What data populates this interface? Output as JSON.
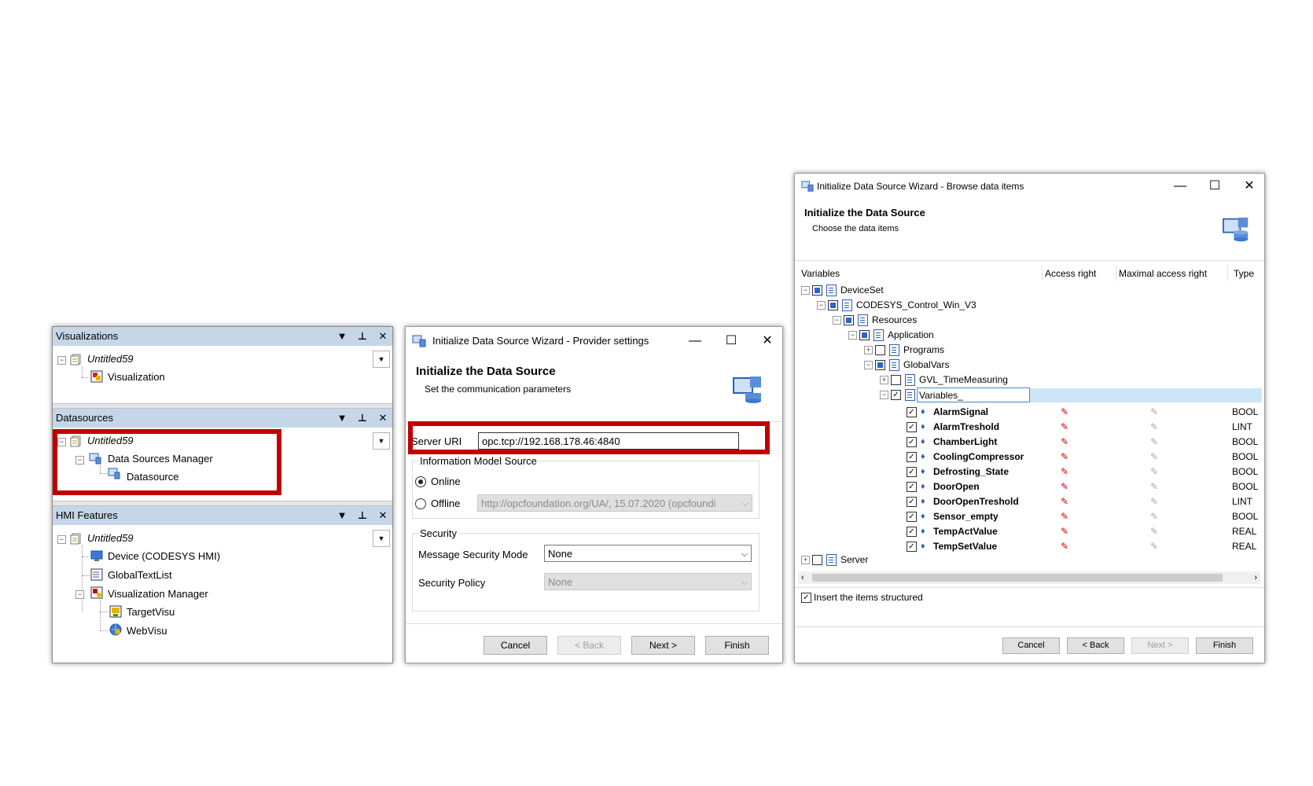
{
  "left_panel": {
    "visualizations": {
      "header": "Visualizations",
      "root": "Untitled59",
      "children": [
        "Visualization"
      ]
    },
    "datasources": {
      "header": "Datasources",
      "root": "Untitled59",
      "manager": "Data Sources Manager",
      "child": "Datasource"
    },
    "hmi_features": {
      "header": "HMI Features",
      "root": "Untitled59",
      "device": "Device (CODESYS HMI)",
      "textlist": "GlobalTextList",
      "manager": "Visualization Manager",
      "target": "TargetVisu",
      "web": "WebVisu"
    }
  },
  "provider_dialog": {
    "title": "Initialize Data Source Wizard - Provider settings",
    "heading": "Initialize the Data Source",
    "subheading": "Set the communication parameters",
    "server_uri_label": "Server URI",
    "server_uri_value": "opc.tcp://192.168.178.46:4840",
    "info_model_group": "Information Model Source",
    "online_label": "Online",
    "offline_label": "Offline",
    "offline_value": "http://opcfoundation.org/UA/, 15.07.2020 (opcfoundi",
    "security_group": "Security",
    "msg_security_label": "Message Security Mode",
    "msg_security_value": "None",
    "policy_label": "Security Policy",
    "policy_value": "None",
    "buttons": {
      "cancel": "Cancel",
      "back": "< Back",
      "next": "Next >",
      "finish": "Finish"
    }
  },
  "browse_dialog": {
    "title": "Initialize Data Source Wizard - Browse data items",
    "heading": "Initialize the Data Source",
    "subheading": "Choose the data items",
    "columns": {
      "variables": "Variables",
      "access": "Access right",
      "max_access": "Maximal access right",
      "type": "Type"
    },
    "tree": {
      "deviceset": "DeviceSet",
      "control": "CODESYS_Control_Win_V3",
      "resources": "Resources",
      "application": "Application",
      "programs": "Programs",
      "globalvars": "GlobalVars",
      "gvl": "GVL_TimeMeasuring",
      "variables": "Variables_",
      "server": "Server"
    },
    "variables": [
      {
        "name": "AlarmSignal",
        "type": "BOOL"
      },
      {
        "name": "AlarmTreshold",
        "type": "LINT"
      },
      {
        "name": "ChamberLight",
        "type": "BOOL"
      },
      {
        "name": "CoolingCompressor",
        "type": "BOOL"
      },
      {
        "name": "Defrosting_State",
        "type": "BOOL"
      },
      {
        "name": "DoorOpen",
        "type": "BOOL"
      },
      {
        "name": "DoorOpenTreshold",
        "type": "LINT"
      },
      {
        "name": "Sensor_empty",
        "type": "BOOL"
      },
      {
        "name": "TempActValue",
        "type": "REAL"
      },
      {
        "name": "TempSetValue",
        "type": "REAL"
      }
    ],
    "insert_structured_label": "Insert the items structured",
    "buttons": {
      "cancel": "Cancel",
      "back": "< Back",
      "next": "Next >",
      "finish": "Finish"
    }
  }
}
